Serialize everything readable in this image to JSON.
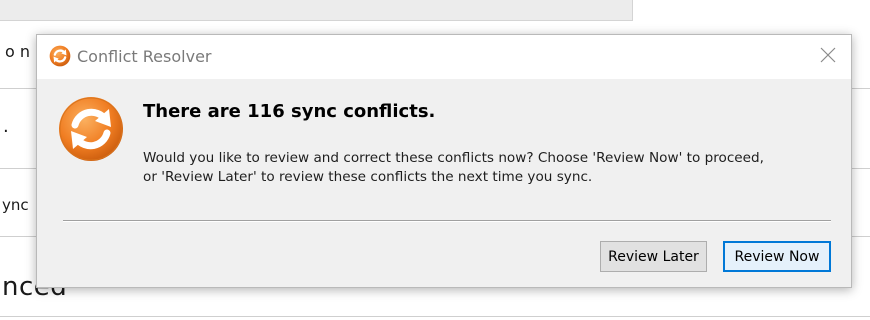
{
  "background": {
    "fragments": [
      "o n",
      ".",
      "ync",
      "nced"
    ]
  },
  "dialog": {
    "title": "Conflict Resolver",
    "close_icon": "close-icon",
    "app_icon": "sync-icon",
    "heading": "There are 116 sync conflicts.",
    "message_lines": [
      "Would you like to review and correct these conflicts now?  Choose 'Review Now' to proceed,",
      "or 'Review Later' to review these conflicts the next time you sync."
    ],
    "buttons": {
      "review_later": "Review Later",
      "review_now": "Review Now"
    }
  },
  "colors": {
    "accent": "#0078d7",
    "icon_orange": "#f07d22"
  }
}
